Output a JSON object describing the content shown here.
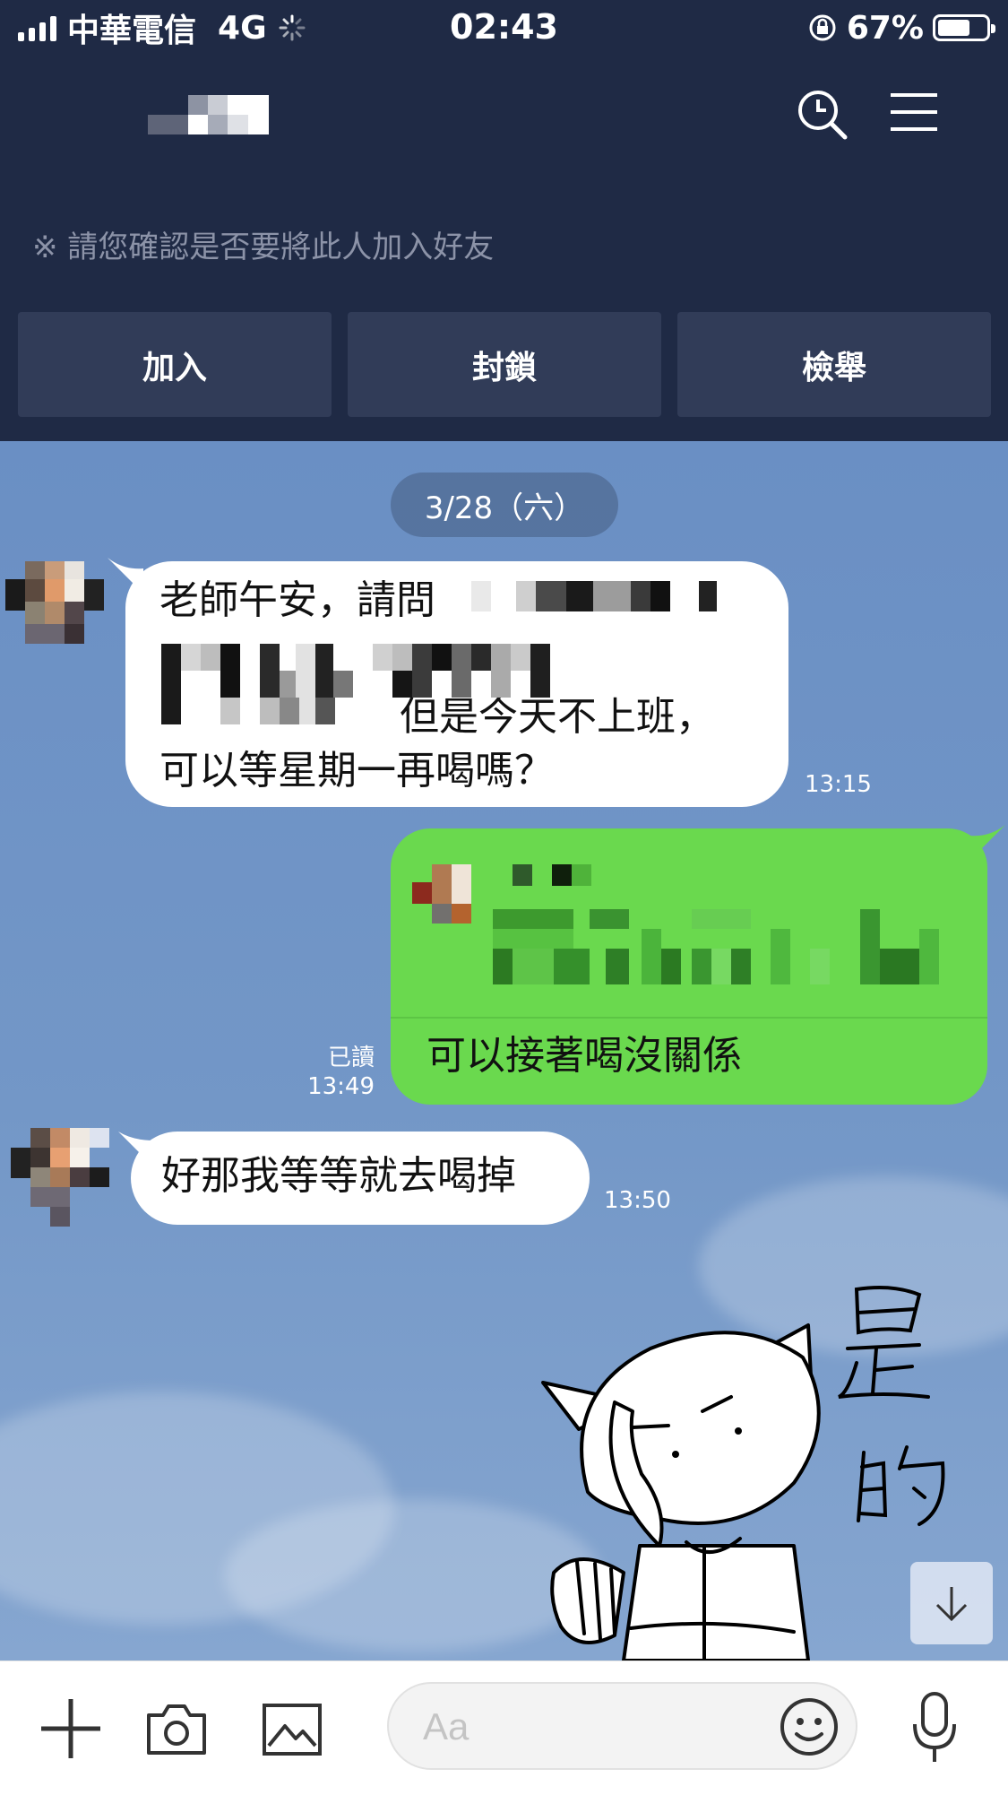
{
  "status_bar": {
    "carrier": "中華電信",
    "network": "4G",
    "time": "02:43",
    "battery": "67%",
    "battery_level": 0.67,
    "icons": [
      "signal-icon",
      "loading-icon",
      "rotation-lock-icon",
      "battery-icon"
    ]
  },
  "header": {
    "contact_name_hidden": true,
    "notice": "※ 請您確認是否要將此人加入好友",
    "actions": [
      {
        "label": "加入"
      },
      {
        "label": "封鎖"
      },
      {
        "label": "檢舉"
      }
    ],
    "icons": [
      "search-icon",
      "menu-icon"
    ]
  },
  "chat": {
    "date_separator": "3/28（六）",
    "messages": [
      {
        "direction": "incoming",
        "lines": [
          "老師午安，請問",
          "",
          "但是今天不上班，",
          "可以等星期一再喝嗎？"
        ],
        "time": "13:15"
      },
      {
        "direction": "outgoing",
        "reply_quote_hidden": true,
        "text": "可以接著喝沒關係",
        "read_label": "已讀",
        "time": "13:49"
      },
      {
        "direction": "incoming",
        "text": "好那我等等就去喝掉",
        "time": "13:50"
      }
    ],
    "sticker": {
      "text": [
        "是",
        "的"
      ],
      "description": "hand-drawn raccoon sticker"
    }
  },
  "input_bar": {
    "placeholder": "Aa",
    "icons": [
      "plus-icon",
      "camera-icon",
      "image-icon",
      "emoji-icon",
      "microphone-icon"
    ]
  },
  "colors": {
    "header_bg": "#1f2a45",
    "button_bg": "#313c58",
    "outgoing_bubble": "#6ad94e",
    "chat_bg": "#6f92c2"
  }
}
